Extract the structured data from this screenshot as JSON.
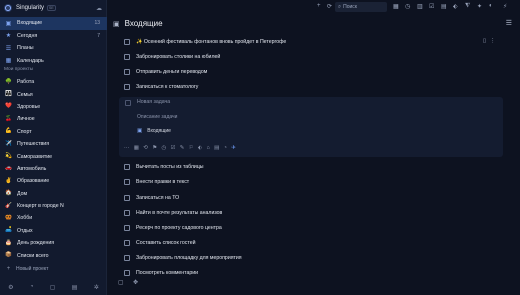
{
  "app": {
    "name": "Singularity",
    "badge": "SE",
    "cloud_icon": "cloud-icon"
  },
  "nav": [
    {
      "label": "Входящие",
      "count": "13",
      "icon": "inbox-icon",
      "active": true
    },
    {
      "label": "Сегодня",
      "count": "7",
      "icon": "star-icon"
    },
    {
      "label": "Планы",
      "count": "",
      "icon": "list-icon"
    },
    {
      "label": "Календарь",
      "count": "",
      "icon": "calendar-icon"
    }
  ],
  "projects_title": "Мои проекты",
  "projects": [
    {
      "emoji": "🌳",
      "label": "Работа"
    },
    {
      "emoji": "👨‍👩‍👧",
      "label": "Семья"
    },
    {
      "emoji": "❤️",
      "label": "Здоровье"
    },
    {
      "emoji": "🍒",
      "label": "Личное"
    },
    {
      "emoji": "💪",
      "label": "Спорт"
    },
    {
      "emoji": "✈️",
      "label": "Путешествия"
    },
    {
      "emoji": "💫",
      "label": "Саморазвитие"
    },
    {
      "emoji": "🚗",
      "label": "Автомобиль"
    },
    {
      "emoji": "✌️",
      "label": "Образование"
    },
    {
      "emoji": "🏠",
      "label": "Дом"
    },
    {
      "emoji": "🎸",
      "label": "Концерт в городе N"
    },
    {
      "emoji": "🥨",
      "label": "Хобби"
    },
    {
      "emoji": "🛋️",
      "label": "Отдых"
    },
    {
      "emoji": "🎂",
      "label": "День рождения"
    },
    {
      "emoji": "📦",
      "label": "Списки всего"
    }
  ],
  "new_project_label": "Новый проект",
  "search": {
    "placeholder": "Поиск"
  },
  "page": {
    "title": "Входящие"
  },
  "tasks_top": [
    "✨ Осенний фестиваль фонтанов вновь пройдет в Петергофе",
    "Забронировать столики на юбилей",
    "Отправить деньги переводом",
    "Записаться к стоматологу"
  ],
  "editor": {
    "title_placeholder": "Новая задача",
    "desc_placeholder": "Описание задачи",
    "project": "Входящие"
  },
  "tasks_bottom": [
    "Вычитать посты из таблицы",
    "Внести правки в текст",
    "Записаться на ТО",
    "Найти в почте результаты анализов",
    "Ресерч по проекту садового центра",
    "Составить список гостей",
    "Забронировать площадку для мероприятия",
    "Посмотреть комментарии"
  ]
}
